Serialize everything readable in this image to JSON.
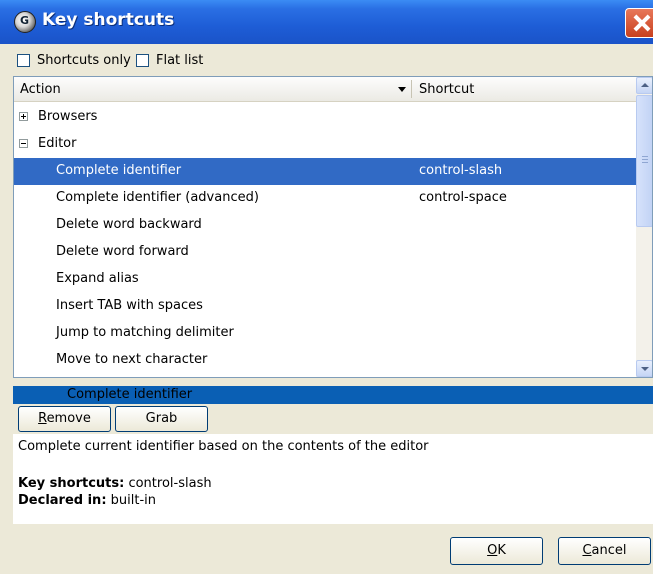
{
  "window": {
    "title": "Key shortcuts",
    "title_icon": "gps-logo-icon",
    "close_icon": "close-icon"
  },
  "options": {
    "shortcuts_only": {
      "label": "Shortcuts only",
      "checked": false
    },
    "flat_list": {
      "label": "Flat list",
      "checked": false
    }
  },
  "grid": {
    "columns": {
      "action": "Action",
      "shortcut": "Shortcut"
    },
    "rows": [
      {
        "kind": "category",
        "expander": "+",
        "action": "Browsers",
        "shortcut": ""
      },
      {
        "kind": "category",
        "expander": "-",
        "action": "Editor",
        "shortcut": ""
      },
      {
        "kind": "item",
        "action": "Complete identifier",
        "shortcut": "control-slash",
        "selected": true
      },
      {
        "kind": "item",
        "action": "Complete identifier (advanced)",
        "shortcut": "control-space"
      },
      {
        "kind": "item",
        "action": "Delete word backward",
        "shortcut": ""
      },
      {
        "kind": "item",
        "action": "Delete word forward",
        "shortcut": ""
      },
      {
        "kind": "item",
        "action": "Expand alias",
        "shortcut": ""
      },
      {
        "kind": "item",
        "action": "Insert TAB with spaces",
        "shortcut": ""
      },
      {
        "kind": "item",
        "action": "Jump to matching delimiter",
        "shortcut": ""
      },
      {
        "kind": "item",
        "action": "Move to next character",
        "shortcut": ""
      }
    ]
  },
  "selected_action": "Complete identifier",
  "buttons": {
    "remove_prefix": "R",
    "remove_rest": "emove",
    "grab": "Grab",
    "ok_prefix": "O",
    "ok_rest": "K",
    "cancel_prefix": "C",
    "cancel_rest": "ancel"
  },
  "details": {
    "description": "Complete current identifier based on the contents of the editor",
    "key_shortcuts_label": "Key shortcuts:",
    "key_shortcuts_value": " control-slash",
    "declared_in_label": "Declared in:",
    "declared_in_value": " built-in"
  },
  "colors": {
    "selection": "#316AC5",
    "titlebar": "#1E5DD6",
    "dialog_bg": "#ECE9D8"
  }
}
